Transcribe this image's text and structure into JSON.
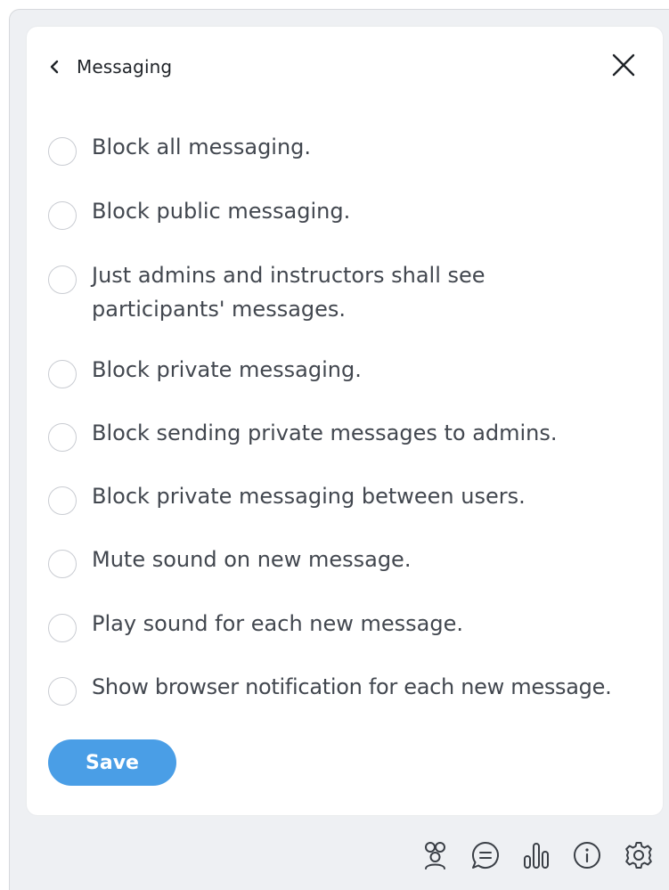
{
  "header": {
    "title": "Messaging",
    "back_icon": "chevron-left-icon",
    "close_icon": "close-icon"
  },
  "options": [
    {
      "label": "Block all messaging.",
      "checked": false
    },
    {
      "label": "Block public messaging.",
      "checked": false
    },
    {
      "label": "Just admins and instructors shall see participants' messages.",
      "checked": false
    },
    {
      "label": "Block private messaging.",
      "checked": false
    },
    {
      "label": "Block sending private messages to admins.",
      "checked": false
    },
    {
      "label": "Block private messaging between users.",
      "checked": false
    },
    {
      "label": "Mute sound on new message.",
      "checked": false
    },
    {
      "label": "Play sound for each new message.",
      "checked": false
    },
    {
      "label": "Show browser notification for each new message.",
      "checked": false
    }
  ],
  "save_label": "Save",
  "toolbar": [
    {
      "icon": "users-icon"
    },
    {
      "icon": "chat-icon"
    },
    {
      "icon": "bar-chart-icon"
    },
    {
      "icon": "info-icon"
    },
    {
      "icon": "settings-icon"
    }
  ],
  "colors": {
    "accent": "#4a9ee6",
    "background": "#eef0f3",
    "panel": "#ffffff",
    "text": "#42474f"
  }
}
